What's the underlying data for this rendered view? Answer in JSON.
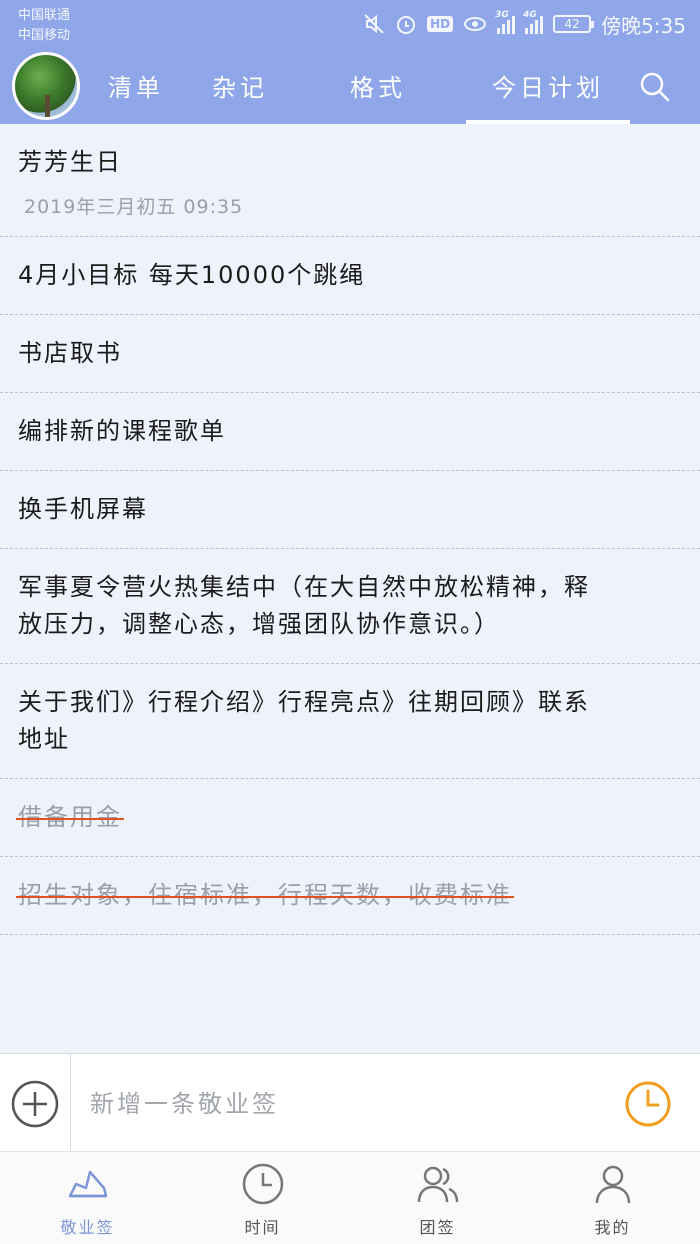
{
  "status_bar": {
    "carrier_1": "中国联通",
    "carrier_2": "中国移动",
    "net_3g": "3G",
    "net_4g": "4G",
    "hd": "HD",
    "battery": "42",
    "time": "傍晚5:35"
  },
  "tabs": [
    {
      "label": "清单"
    },
    {
      "label": "杂记"
    },
    {
      "label": "格式"
    },
    {
      "label": "今日计划"
    }
  ],
  "active_tab": 3,
  "items": [
    {
      "text": "芳芳生日",
      "date": "2019年三月初五 09:35",
      "done": false
    },
    {
      "text": "4月小目标 每天10000个跳绳",
      "done": false
    },
    {
      "text": "书店取书",
      "done": false
    },
    {
      "text": "编排新的课程歌单",
      "done": false
    },
    {
      "text": "换手机屏幕",
      "done": false
    },
    {
      "text": "军事夏令营火热集结中（在大自然中放松精神，释放压力，调整心态，增强团队协作意识。）",
      "done": false
    },
    {
      "text": "关于我们》行程介绍》行程亮点》往期回顾》联系地址",
      "done": false
    },
    {
      "text": "借备用金",
      "done": true
    },
    {
      "text": "招生对象，住宿标准，行程天数，收费标准",
      "done": true
    }
  ],
  "input": {
    "placeholder": "新增一条敬业签"
  },
  "bottom_nav": [
    {
      "label": "敬业签",
      "icon": "boat-icon"
    },
    {
      "label": "时间",
      "icon": "clock-icon"
    },
    {
      "label": "团签",
      "icon": "group-icon"
    },
    {
      "label": "我的",
      "icon": "person-icon"
    }
  ],
  "colors": {
    "header": "#8fa7e8",
    "accent": "#7b95d6",
    "strike": "#e0531f",
    "clock": "#f0a020"
  }
}
